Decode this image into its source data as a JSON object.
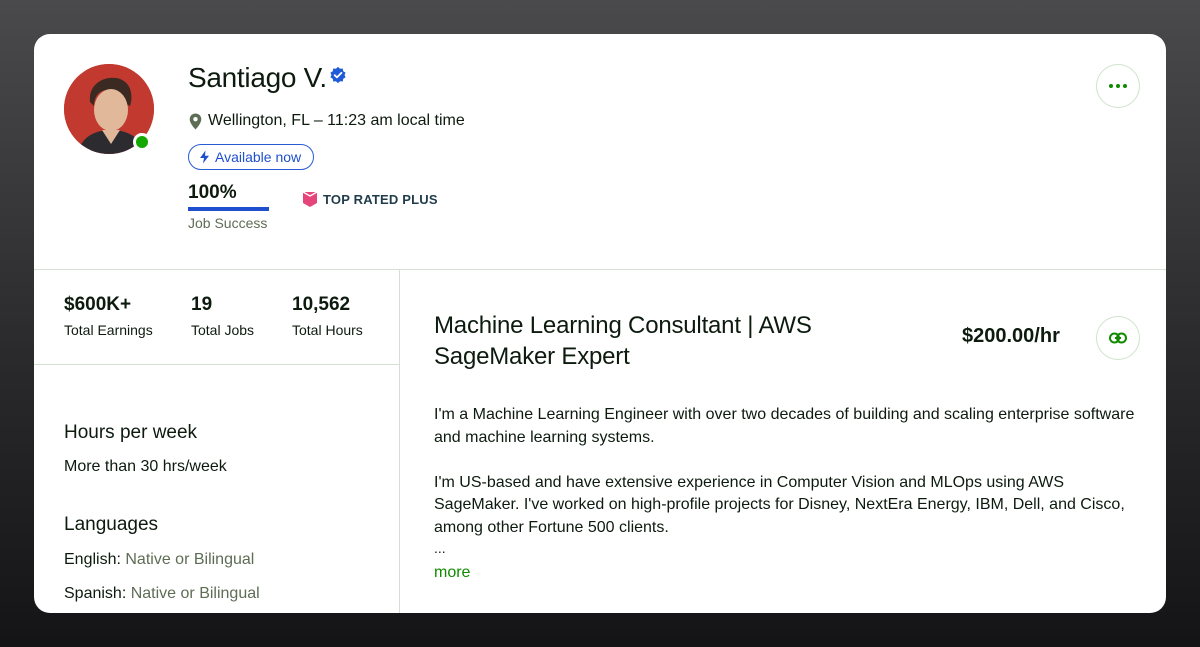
{
  "profile": {
    "name": "Santiago V.",
    "location": "Wellington, FL – 11:23 am local time",
    "availability": "Available now",
    "job_success": {
      "value": "100%",
      "label": "Job Success",
      "fraction": 1.0
    },
    "badge": "TOP RATED PLUS"
  },
  "stats": [
    {
      "value": "$600K+",
      "label": "Total Earnings"
    },
    {
      "value": "19",
      "label": "Total Jobs"
    },
    {
      "value": "10,562",
      "label": "Total Hours"
    }
  ],
  "hours": {
    "title": "Hours per week",
    "value": "More than 30 hrs/week"
  },
  "languages": {
    "title": "Languages",
    "items": [
      {
        "name": "English:",
        "level": "Native or Bilingual"
      },
      {
        "name": "Spanish:",
        "level": "Native or Bilingual"
      }
    ]
  },
  "headline": {
    "title": "Machine Learning Consultant | AWS SageMaker Expert",
    "rate": "$200.00/hr"
  },
  "bio": {
    "paragraphs": [
      "I'm a Machine Learning Engineer with over two decades of building and scaling enterprise software and machine learning systems.",
      "I'm US-based and have extensive experience in Computer Vision and MLOps using AWS SageMaker. I've worked on high-profile projects for Disney, NextEra Energy, IBM, Dell, and Cisco, among other Fortune 500 clients."
    ],
    "ellipsis": "...",
    "more_label": "more"
  },
  "colors": {
    "accent_green": "#108a00",
    "accent_blue": "#1f4fcc",
    "badge_pink": "#e5457a",
    "online": "#14a800"
  },
  "icons": {
    "verified": "verified-check-icon",
    "location": "map-pin-icon",
    "availability": "lightning-icon",
    "badge": "top-rated-plus-icon",
    "more": "more-dots-icon",
    "link": "link-icon"
  }
}
